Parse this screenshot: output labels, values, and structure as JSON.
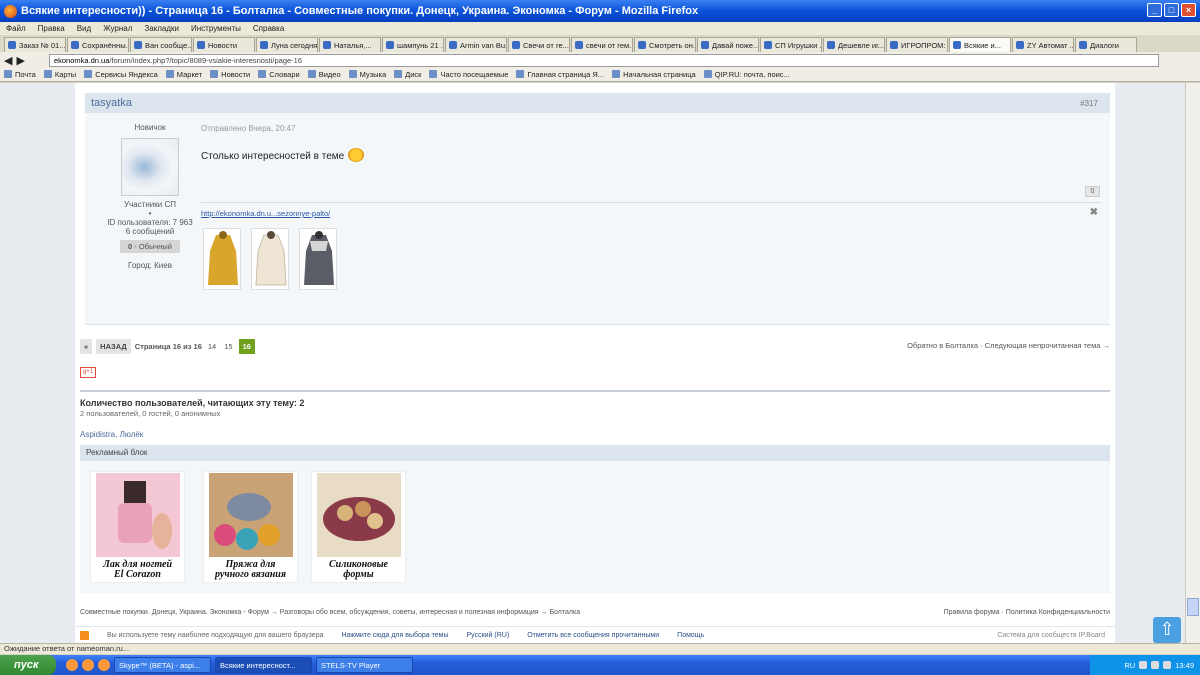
{
  "window": {
    "title": "Всякие интересности)) - Страница 16 - Болталка - Совместные покупки. Донецк, Украина. Экономка - Форум - Mozilla Firefox"
  },
  "menu": [
    "Файл",
    "Правка",
    "Вид",
    "Журнал",
    "Закладки",
    "Инструменты",
    "Справка"
  ],
  "tabs": [
    "Заказ № 01...",
    "Сохранённы...",
    "Ван сообще...",
    "Новости",
    "Луна сегодня",
    "Наталья,...",
    "шампунь 21 ...",
    "Armin van Bu...",
    "Свечи от ге...",
    "свечи от гем...",
    "Смотреть он...",
    "Давай поже...",
    "СП Игрушки ...",
    "Дешевле иг...",
    "ИГРОПРОМ: ...",
    "Всякие и...",
    "ZY Автомат ...",
    "Диалоги"
  ],
  "url": {
    "domain": "ekonomka.dn.ua",
    "path": "/forum/index.php?/topic/8089-vsiakie-interesnosti/page-16"
  },
  "bookmarks": [
    "Почта",
    "Карты",
    "Сервисы Яндекса",
    "Маркет",
    "Новости",
    "Словари",
    "Видео",
    "Музыка",
    "Диск",
    "Часто посещаемые",
    "Главная страница Я...",
    "Начальная страница",
    "QIP.RU: почта, поис..."
  ],
  "post": {
    "author": "tasyatka",
    "number": "#317",
    "rank": "Новичок",
    "group": "Участники СП",
    "user_id": "ID пользователя: 7 963",
    "messages": "6 сообщений",
    "reputation": "0",
    "rep_label": "Обычный",
    "city": "Город: Киев",
    "posted": "Отправлено Вчера, 20:47",
    "text": "Столько интересностей в теме",
    "likes": "0",
    "sig_link": "http://ekonomka.dn.u...sezonnye-palto/"
  },
  "pager": {
    "back": "НАЗАД",
    "info": "Страница 16 из 16",
    "pages": [
      "14",
      "15"
    ],
    "current": "16",
    "right": "Обратно в Болталка · Следующая непрочитанная тема →"
  },
  "gplus": "g+1",
  "readers": {
    "title": "Количество пользователей, читающих эту тему: 2",
    "sub": "2 пользователей, 0 гостей, 0 анонимных",
    "names": "Aspidistra, Люлёк"
  },
  "ads": {
    "title": "Рекламный блок",
    "items": [
      {
        "caption1": "Лак для ногтей",
        "caption2": "El Corazon"
      },
      {
        "caption1": "Пряжа для",
        "caption2": "ручного вязания"
      },
      {
        "caption1": "Силиконовые",
        "caption2": "формы"
      }
    ]
  },
  "crumbs": {
    "left": "Совместные покупки. Донецк, Украина. Экономка - Форум → Разговоры обо всем, обсуждения, советы, интересная и полезная информация → Болталка",
    "right": "Правила форума · Политика Конфиденциальности"
  },
  "footer": {
    "note": "Вы используете тему наиболее подходящую для вашего браузера",
    "choose": "Нажмите сюда для выбора темы",
    "lang": "Русский (RU)",
    "mark": "Отметить все сообщения прочитанными",
    "help": "Помощь",
    "ipb": "Система для сообществ IP.Board"
  },
  "status": "Ожидание ответа от nameoman.ru...",
  "taskbar": {
    "start": "пуск",
    "tasks": [
      "Skype™ (BETA) - aspi...",
      "Всякие интересност...",
      "STELS-TV Player"
    ],
    "lang": "RU",
    "time": "13:49"
  }
}
